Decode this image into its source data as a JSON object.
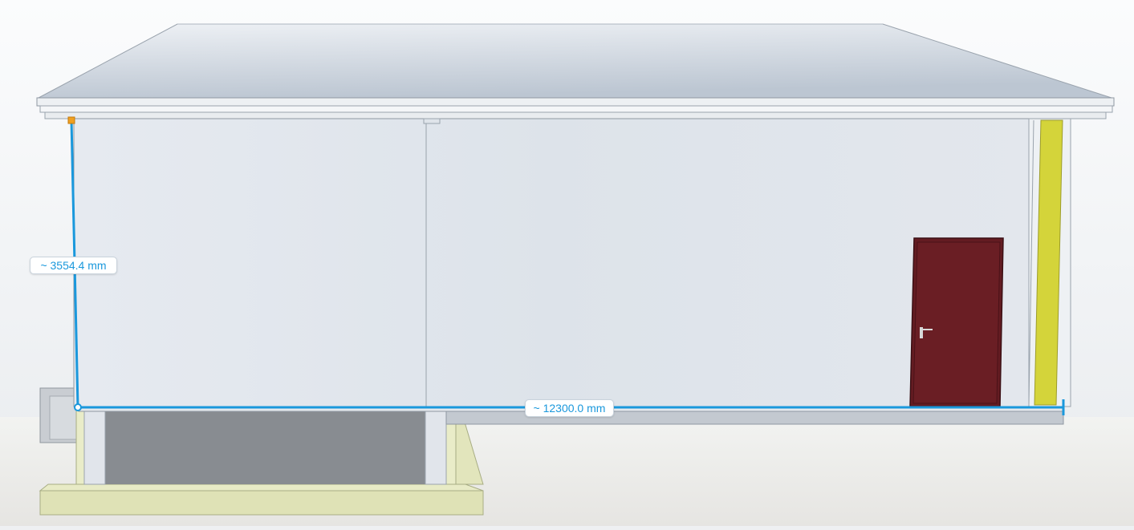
{
  "viewport": {
    "colors": {
      "measure_line": "#1a98dc",
      "measure_text": "#1a98dc",
      "door": "#641c22",
      "yellow_strip": "#d4d43a",
      "foundation": "#dfe2b6",
      "sky_top": "#ffffff",
      "sky_bottom": "#e9ecef"
    }
  },
  "measurements": {
    "height_label": "~ 3554.4 mm",
    "width_label": "~ 12300.0 mm"
  }
}
